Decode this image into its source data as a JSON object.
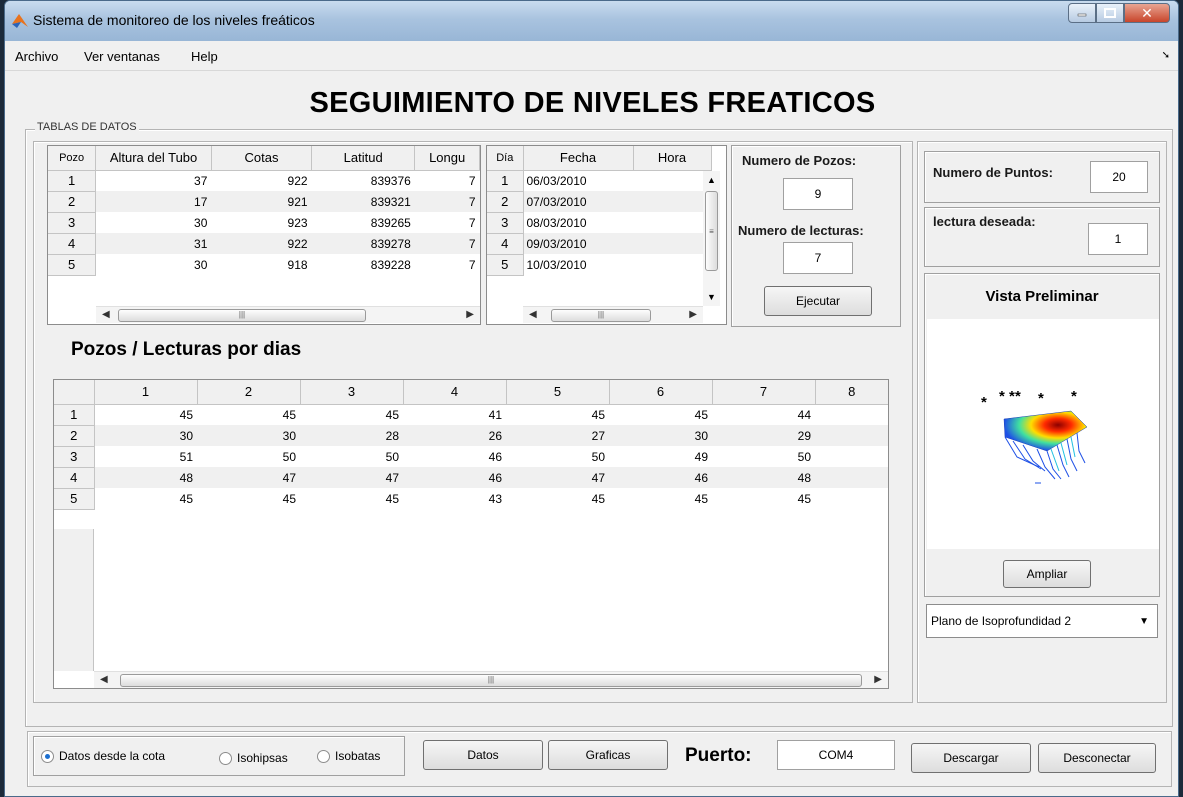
{
  "window": {
    "title": "Sistema de monitoreo de los niveles freáticos"
  },
  "menu": {
    "items": [
      "Archivo",
      "Ver ventanas",
      "Help"
    ]
  },
  "main_title": "SEGUIMIENTO DE NIVELES FREATICOS",
  "group_label": "TABLAS DE DATOS",
  "table_pozos": {
    "headers": [
      "Pozo",
      "Altura del Tubo",
      "Cotas",
      "Latitud",
      "Longu"
    ],
    "rows": [
      [
        "1",
        "37",
        "922",
        "839376",
        "7"
      ],
      [
        "2",
        "17",
        "921",
        "839321",
        "7"
      ],
      [
        "3",
        "30",
        "923",
        "839265",
        "7"
      ],
      [
        "4",
        "31",
        "922",
        "839278",
        "7"
      ],
      [
        "5",
        "30",
        "918",
        "839228",
        "7"
      ]
    ]
  },
  "table_dias": {
    "headers": [
      "Día",
      "Fecha",
      "Hora"
    ],
    "rows": [
      [
        "1",
        "06/03/2010",
        ""
      ],
      [
        "2",
        "07/03/2010",
        ""
      ],
      [
        "3",
        "08/03/2010",
        ""
      ],
      [
        "4",
        "09/03/2010",
        ""
      ],
      [
        "5",
        "10/03/2010",
        ""
      ]
    ]
  },
  "control": {
    "num_pozos_label": "Numero de Pozos:",
    "num_pozos_value": "9",
    "num_lecturas_label": "Numero de lecturas:",
    "num_lecturas_value": "7",
    "ejecutar": "Ejecutar"
  },
  "subheading": "Pozos / Lecturas por dias",
  "table_lecturas": {
    "headers": [
      "",
      "1",
      "2",
      "3",
      "4",
      "5",
      "6",
      "7",
      "8"
    ],
    "rows": [
      [
        "1",
        "45",
        "45",
        "45",
        "41",
        "45",
        "45",
        "44",
        ""
      ],
      [
        "2",
        "30",
        "30",
        "28",
        "26",
        "27",
        "30",
        "29",
        ""
      ],
      [
        "3",
        "51",
        "50",
        "50",
        "46",
        "50",
        "49",
        "50",
        ""
      ],
      [
        "4",
        "48",
        "47",
        "47",
        "46",
        "47",
        "46",
        "48",
        ""
      ],
      [
        "5",
        "45",
        "45",
        "45",
        "43",
        "45",
        "45",
        "45",
        ""
      ]
    ]
  },
  "right": {
    "num_puntos_label": "Numero de Puntos:",
    "num_puntos_value": "20",
    "lectura_label": "lectura deseada:",
    "lectura_value": "1",
    "vista_title": "Vista Preliminar",
    "ampliar": "Ampliar",
    "plot_select": "Plano de Isoprofundidad 2"
  },
  "bottom": {
    "radio_cota": "Datos desde la cota",
    "radio_isohipsas": "Isohipsas",
    "radio_isobatas": "Isobatas",
    "datos": "Datos",
    "graficas": "Graficas",
    "puerto_label": "Puerto:",
    "puerto_value": "COM4",
    "descargar": "Descargar",
    "desconectar": "Desconectar"
  }
}
